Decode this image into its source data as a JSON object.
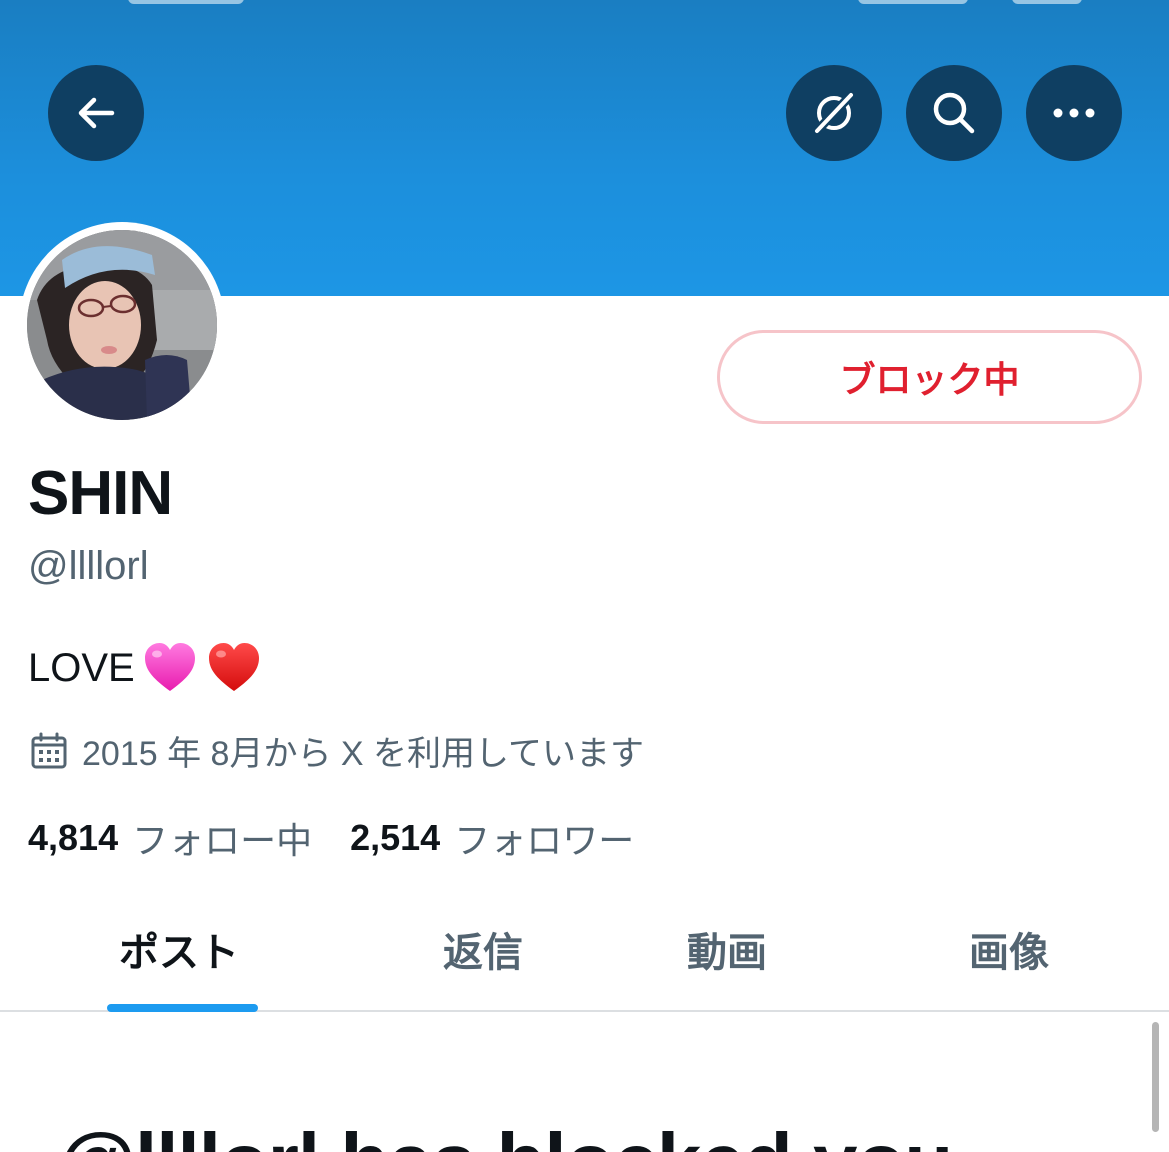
{
  "header": {
    "back_icon": "arrow-left-icon",
    "grok_icon": "grok-icon",
    "search_icon": "search-icon",
    "more_icon": "more-horizontal-icon",
    "banner_color": "#1c8fdc"
  },
  "profile": {
    "display_name": "SHIN",
    "handle": "@llllorl",
    "bio_text": "LOVE",
    "bio_emoji": [
      "pink-heart-emoji",
      "red-heart-emoji"
    ],
    "joined_icon": "calendar-icon",
    "joined_text": "2015 年 8月から X を利用しています",
    "block_button_label": "ブロック中",
    "block_color": "#e0202f"
  },
  "stats": {
    "following_count": "4,814",
    "following_label": "フォロー中",
    "followers_count": "2,514",
    "followers_label": "フォロワー"
  },
  "tabs": [
    {
      "label": "ポスト",
      "active": true
    },
    {
      "label": "返信",
      "active": false
    },
    {
      "label": "動画",
      "active": false
    },
    {
      "label": "画像",
      "active": false
    }
  ],
  "accent_color": "#1d9bf0",
  "blocked_message": "@llllorl has blocked you"
}
